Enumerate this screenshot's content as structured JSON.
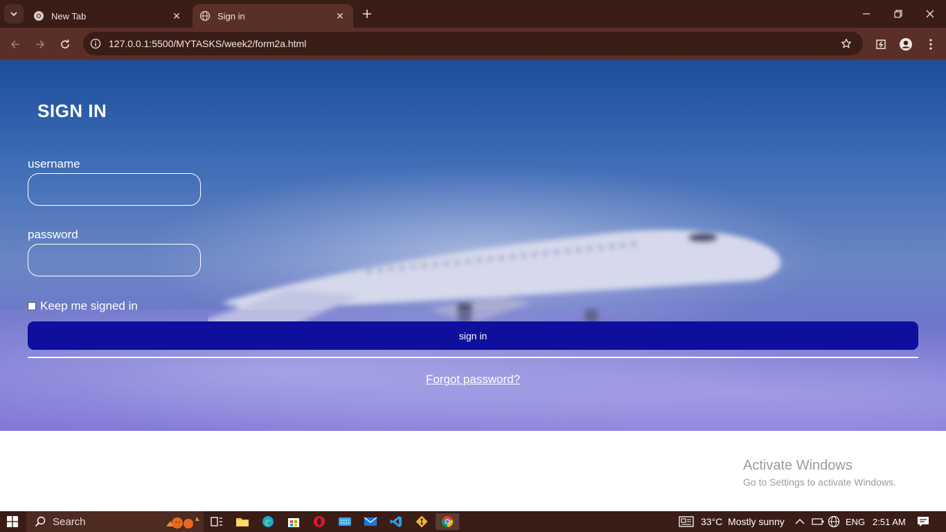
{
  "browser": {
    "tabs": [
      {
        "title": "New Tab",
        "active": false
      },
      {
        "title": "Sign in",
        "active": true
      }
    ],
    "url": "127.0.0.1:5500/MYTASKS/week2/form2a.html"
  },
  "form": {
    "title": "SIGN IN",
    "username_label": "username",
    "username_value": "",
    "password_label": "password",
    "password_value": "",
    "keep_signed_in_label": "Keep me signed in",
    "keep_signed_in_checked": false,
    "submit_label": "sign in",
    "forgot_link": "Forgot password?"
  },
  "watermark": {
    "line1": "Activate Windows",
    "line2": "Go to Settings to activate Windows."
  },
  "taskbar": {
    "search_label": "Search",
    "weather": "33°C  Mostly sunny",
    "language": "ENG",
    "time": "2:51 AM"
  },
  "colors": {
    "chrome_dark": "#3a1d17",
    "chrome_toolbar": "#5a2f27",
    "button": "#0e0f9c"
  }
}
